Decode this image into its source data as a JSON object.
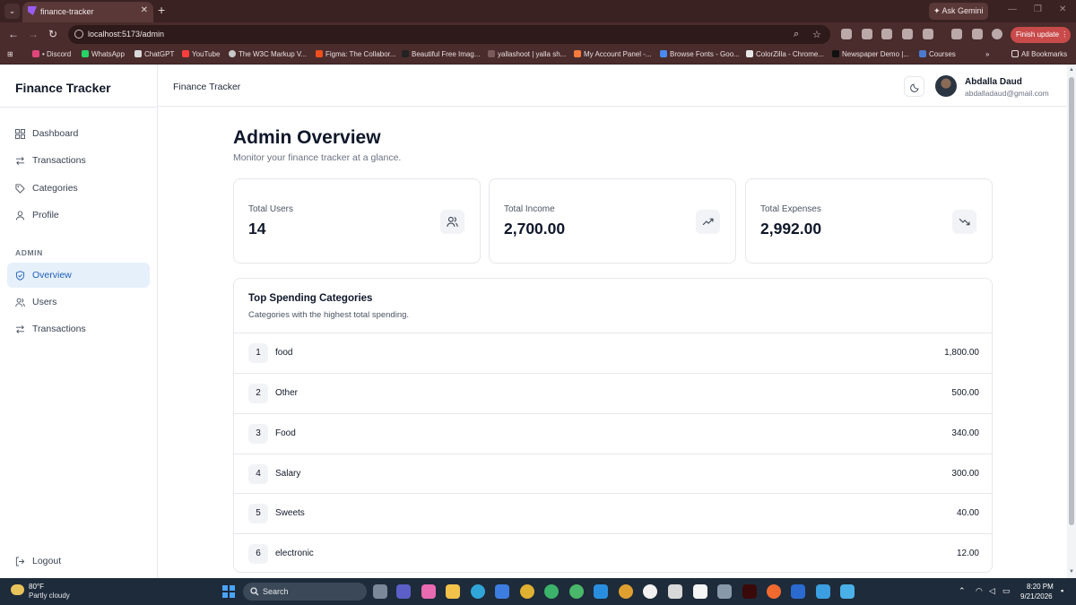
{
  "browser": {
    "tab_title": "finance-tracker",
    "new_tab": "+",
    "url": "localhost:5173/admin",
    "ask_gemini": "Ask Gemini",
    "finish_update": "Finish update",
    "bookmarks": [
      {
        "label": "• Discord",
        "color": "#e0457b"
      },
      {
        "label": "WhatsApp",
        "color": "#25d366"
      },
      {
        "label": "ChatGPT",
        "color": "#d9d9d9"
      },
      {
        "label": "YouTube",
        "color": "#ff3d3d"
      },
      {
        "label": "The W3C Markup V...",
        "color": "#c8c8c8"
      },
      {
        "label": "Figma: The Collabor...",
        "color": "#f24e1e"
      },
      {
        "label": "Beautiful Free Imag...",
        "color": "#222222"
      },
      {
        "label": "yallashoot | yalla sh...",
        "color": "#7a5a5a"
      },
      {
        "label": "My Account Panel -...",
        "color": "#ff7a3d"
      },
      {
        "label": "Browse Fonts - Goo...",
        "color": "#4a8af4"
      },
      {
        "label": "ColorZilla - Chrome...",
        "color": "#e8e8e8"
      },
      {
        "label": "Newspaper Demo |...",
        "color": "#111111"
      },
      {
        "label": "Courses",
        "color": "#4a7bd0"
      }
    ],
    "all_bookmarks": "All Bookmarks"
  },
  "app": {
    "brand": "Finance Tracker",
    "header_title": "Finance Tracker",
    "user": {
      "name": "Abdalla Daud",
      "email": "abdalladaud@gmail.com"
    },
    "nav": {
      "items": [
        {
          "label": "Dashboard",
          "icon": "grid-icon"
        },
        {
          "label": "Transactions",
          "icon": "swap-icon"
        },
        {
          "label": "Categories",
          "icon": "tag-icon"
        },
        {
          "label": "Profile",
          "icon": "user-icon"
        }
      ],
      "admin_section": "ADMIN",
      "admin_items": [
        {
          "label": "Overview",
          "icon": "shield-icon",
          "active": true
        },
        {
          "label": "Users",
          "icon": "users-icon"
        },
        {
          "label": "Transactions",
          "icon": "swap-icon"
        }
      ],
      "logout": "Logout"
    },
    "page": {
      "title": "Admin Overview",
      "subtitle": "Monitor your finance tracker at a glance."
    },
    "stats": [
      {
        "label": "Total Users",
        "value": "14",
        "icon": "users-icon"
      },
      {
        "label": "Total Income",
        "value": "2,700.00",
        "icon": "trend-up-icon"
      },
      {
        "label": "Total Expenses",
        "value": "2,992.00",
        "icon": "trend-down-icon"
      }
    ],
    "categories": {
      "title": "Top Spending Categories",
      "subtitle": "Categories with the highest total spending.",
      "rows": [
        {
          "rank": "1",
          "name": "food",
          "amount": "1,800.00"
        },
        {
          "rank": "2",
          "name": "Other",
          "amount": "500.00"
        },
        {
          "rank": "3",
          "name": "Food",
          "amount": "340.00"
        },
        {
          "rank": "4",
          "name": "Salary",
          "amount": "300.00"
        },
        {
          "rank": "5",
          "name": "Sweets",
          "amount": "40.00"
        },
        {
          "rank": "6",
          "name": "electronic",
          "amount": "12.00"
        }
      ]
    }
  },
  "taskbar": {
    "temperature": "80°F",
    "weather": "Partly cloudy",
    "search": "Search",
    "time": "8:20 PM",
    "date": "9/21/2026"
  }
}
